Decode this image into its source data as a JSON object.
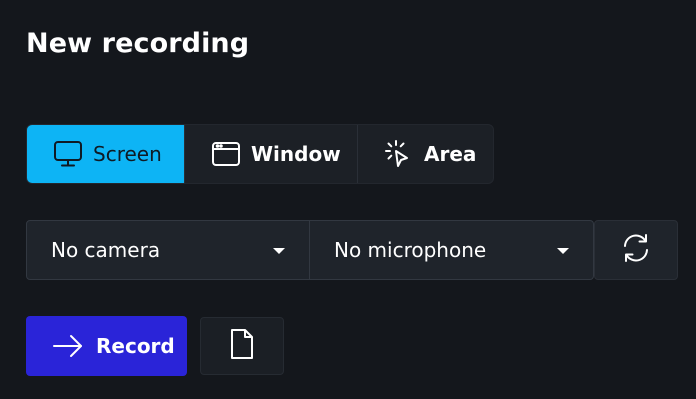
{
  "header": {
    "title": "New recording"
  },
  "source": {
    "tabs": [
      {
        "label": "Screen",
        "icon": "monitor-icon",
        "active": true
      },
      {
        "label": "Window",
        "icon": "window-icon",
        "active": false
      },
      {
        "label": "Area",
        "icon": "area-select-cursor-icon",
        "active": false
      }
    ]
  },
  "devices": {
    "camera": {
      "selected": "No camera"
    },
    "microphone": {
      "selected": "No microphone"
    },
    "refresh_icon": "refresh-icon"
  },
  "actions": {
    "record_label": "Record",
    "record_icon": "arrow-right-icon",
    "file_icon": "file-icon"
  },
  "colors": {
    "background": "#14171c",
    "active_tab": "#0db4f5",
    "record_button": "#2a24d8",
    "panel": "#1f242b"
  }
}
